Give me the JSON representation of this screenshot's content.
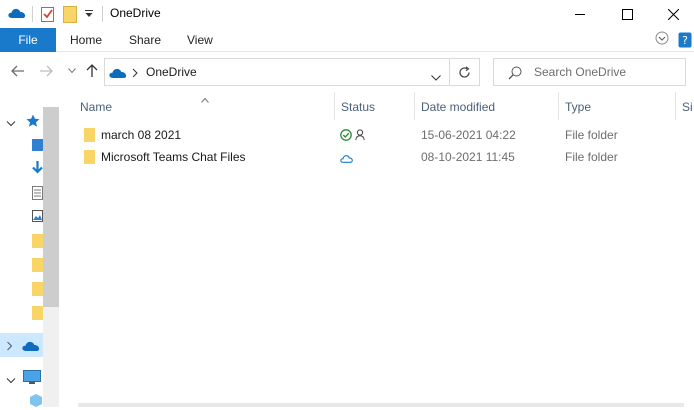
{
  "window": {
    "title": "OneDrive",
    "colors": {
      "accent": "#1979ca",
      "onedrive_blue": "#0f6cbd",
      "folder_yellow": "#f9d568",
      "selection": "#cce8ff",
      "sync_green": "#2e8b3e"
    }
  },
  "ribbon": {
    "file_label": "File",
    "tabs": [
      "Home",
      "Share",
      "View"
    ]
  },
  "address": {
    "breadcrumb": [
      "OneDrive"
    ],
    "search_placeholder": "Search OneDrive"
  },
  "columns": {
    "name": "Name",
    "status": "Status",
    "date_modified": "Date modified",
    "type": "Type",
    "size": "Si"
  },
  "files": [
    {
      "name": "march 08 2021",
      "status": "synced-shared",
      "date_modified": "15-06-2021 04:22",
      "type": "File folder"
    },
    {
      "name": "Microsoft Teams Chat Files",
      "status": "cloud-only",
      "date_modified": "08-10-2021 11:45",
      "type": "File folder"
    }
  ],
  "navpane": {
    "icons": [
      "quick-access-star-icon",
      "desktop-icon",
      "downloads-icon",
      "documents-icon",
      "pictures-icon",
      "folder-icon",
      "folder-icon",
      "folder-icon",
      "folder-icon",
      "onedrive-cloud-icon",
      "this-pc-icon",
      "3d-objects-icon"
    ]
  }
}
